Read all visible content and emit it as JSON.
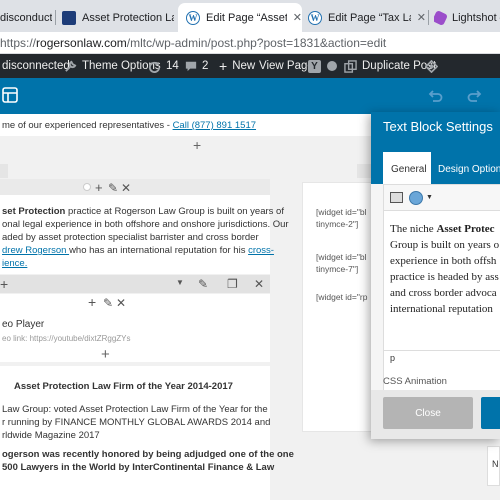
{
  "browser": {
    "tabs": [
      {
        "label": "disconduct",
        "icon": "none",
        "active": false
      },
      {
        "label": "Asset Protection Lawyer",
        "icon": "square-favicon-icon",
        "active": false
      },
      {
        "label": "Edit Page “Asset Protectio",
        "icon": "wordpress-icon",
        "active": true
      },
      {
        "label": "Edit Page “Tax Lawyer To",
        "icon": "wordpress-icon",
        "active": false
      },
      {
        "label": "Lightshot — sc",
        "icon": "lightshot-icon",
        "active": false
      }
    ],
    "tab_close": "✕",
    "url_prefix": "https://",
    "url_host": "rogersonlaw.com",
    "url_path": "/mltc/wp-admin/post.php?post=1831&action=edit"
  },
  "admin_bar": {
    "items": [
      {
        "label": "disconnected",
        "icon": ""
      },
      {
        "label": "Theme Options",
        "icon": "wrench-icon"
      },
      {
        "label": "14",
        "icon": "refresh-icon"
      },
      {
        "label": "2",
        "icon": "comment-icon"
      },
      {
        "label": "New",
        "icon": "plus-icon"
      },
      {
        "label": "View Page",
        "icon": ""
      },
      {
        "label": "",
        "icon": "yoast-icon"
      },
      {
        "label": "",
        "icon": "dot-badge-icon"
      },
      {
        "label": "Duplicate Post",
        "icon": "duplicate-icon"
      },
      {
        "label": "",
        "icon": "diamond-icon"
      }
    ]
  },
  "builder": {
    "layout_icon": "layout-icon",
    "undo_icon": "undo-icon",
    "redo_icon": "redo-icon"
  },
  "content": {
    "top_text": "me of our experienced representatives - ",
    "top_phone": "Call (877) 891 1517",
    "para1_bold": "set Protection",
    "para1_a": " practice at Rogerson Law Group is built on years of",
    "para1_b": "onal legal experience in both offshore and onshore jurisdictions. Our",
    "para1_c": "aded by asset protection specialist barrister and cross border",
    "para1_link": "drew Rogerson ",
    "para1_d": "who has an international reputation for his ",
    "para1_link2a": "cross-",
    "para1_link2b": "ience.",
    "video_title": "eo Player",
    "video_link": "eo link: https://youtube/dixtZRggZYs",
    "award_title": "Asset Protection Law Firm of the Year 2014-2017",
    "award1": "Law Group: voted Asset Protection Law Firm of the Year for the",
    "award2": "r running by FINANCE MONTHLY GLOBAL AWARDS 2014 and",
    "award3": "rldwide Magazine 2017",
    "award4": "ogerson was recently honored by being adjudged one of the one",
    "award5": " 500 Lawyers in the World by InterContinental Finance & Law",
    "widgets": [
      "[widget id=\"bl",
      "tinymce-2\"]",
      "[widget id=\"bl",
      "tinymce-7\"]",
      "[widget id=\"rp"
    ],
    "side_letter": "N"
  },
  "modal": {
    "title": "Text Block Settings",
    "tab_general": "General",
    "tab_design": "Design Options",
    "editor_line1_a": "The niche ",
    "editor_line1_bold": "Asset Protec",
    "editor_line2": "Group is built on years o",
    "editor_line3": "experience in both offsh",
    "editor_line4": "practice is headed by ass",
    "editor_line5": "and cross border advoca",
    "editor_line6": "international reputation",
    "status_path": "p",
    "section_label": "CSS Animation",
    "close_label": "Close"
  },
  "colors": {
    "admin_bar": "#23282d",
    "builder_blue": "#0073aa",
    "link": "#0073aa",
    "close_button": "#b4b4b4"
  }
}
